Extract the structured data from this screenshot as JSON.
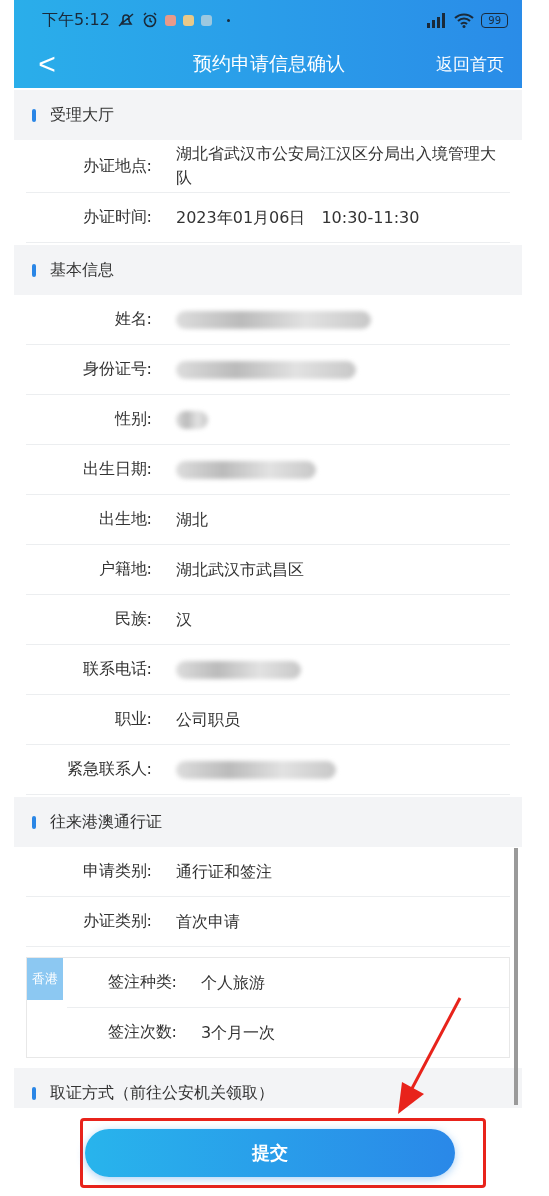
{
  "status_bar": {
    "time": "下午5:12",
    "battery": "99"
  },
  "nav": {
    "back": "<",
    "title": "预约申请信息确认",
    "home": "返回首页"
  },
  "sections": [
    {
      "title": "受理大厅",
      "rows": [
        {
          "kind": "text",
          "label": "办证地点:",
          "value": "湖北省武汉市公安局江汉区分局出入境管理大队"
        },
        {
          "kind": "text",
          "label": "办证时间:",
          "value": "2023年01月06日　10:30-11:30"
        }
      ]
    },
    {
      "title": "基本信息",
      "rows": [
        {
          "kind": "redacted",
          "label": "姓名:"
        },
        {
          "kind": "redacted",
          "label": "身份证号:"
        },
        {
          "kind": "redacted",
          "label": "性别:"
        },
        {
          "kind": "redacted",
          "label": "出生日期:"
        },
        {
          "kind": "text",
          "label": "出生地:",
          "value": "湖北"
        },
        {
          "kind": "text",
          "label": "户籍地:",
          "value": "湖北武汉市武昌区"
        },
        {
          "kind": "text",
          "label": "民族:",
          "value": "汉"
        },
        {
          "kind": "redacted",
          "label": "联系电话:"
        },
        {
          "kind": "text",
          "label": "职业:",
          "value": "公司职员"
        },
        {
          "kind": "redacted",
          "label": "紧急联系人:"
        }
      ]
    },
    {
      "title": "往来港澳通行证",
      "rows": [
        {
          "kind": "text",
          "label": "申请类别:",
          "value": "通行证和签注"
        },
        {
          "kind": "text",
          "label": "办证类别:",
          "value": "首次申请"
        }
      ],
      "visa_card": {
        "tag": "香港",
        "rows": [
          {
            "label": "签注种类:",
            "value": "个人旅游"
          },
          {
            "label": "签注次数:",
            "value": "3个月一次"
          }
        ]
      }
    },
    {
      "title": "取证方式（前往公安机关领取）"
    }
  ],
  "submit": "提交"
}
